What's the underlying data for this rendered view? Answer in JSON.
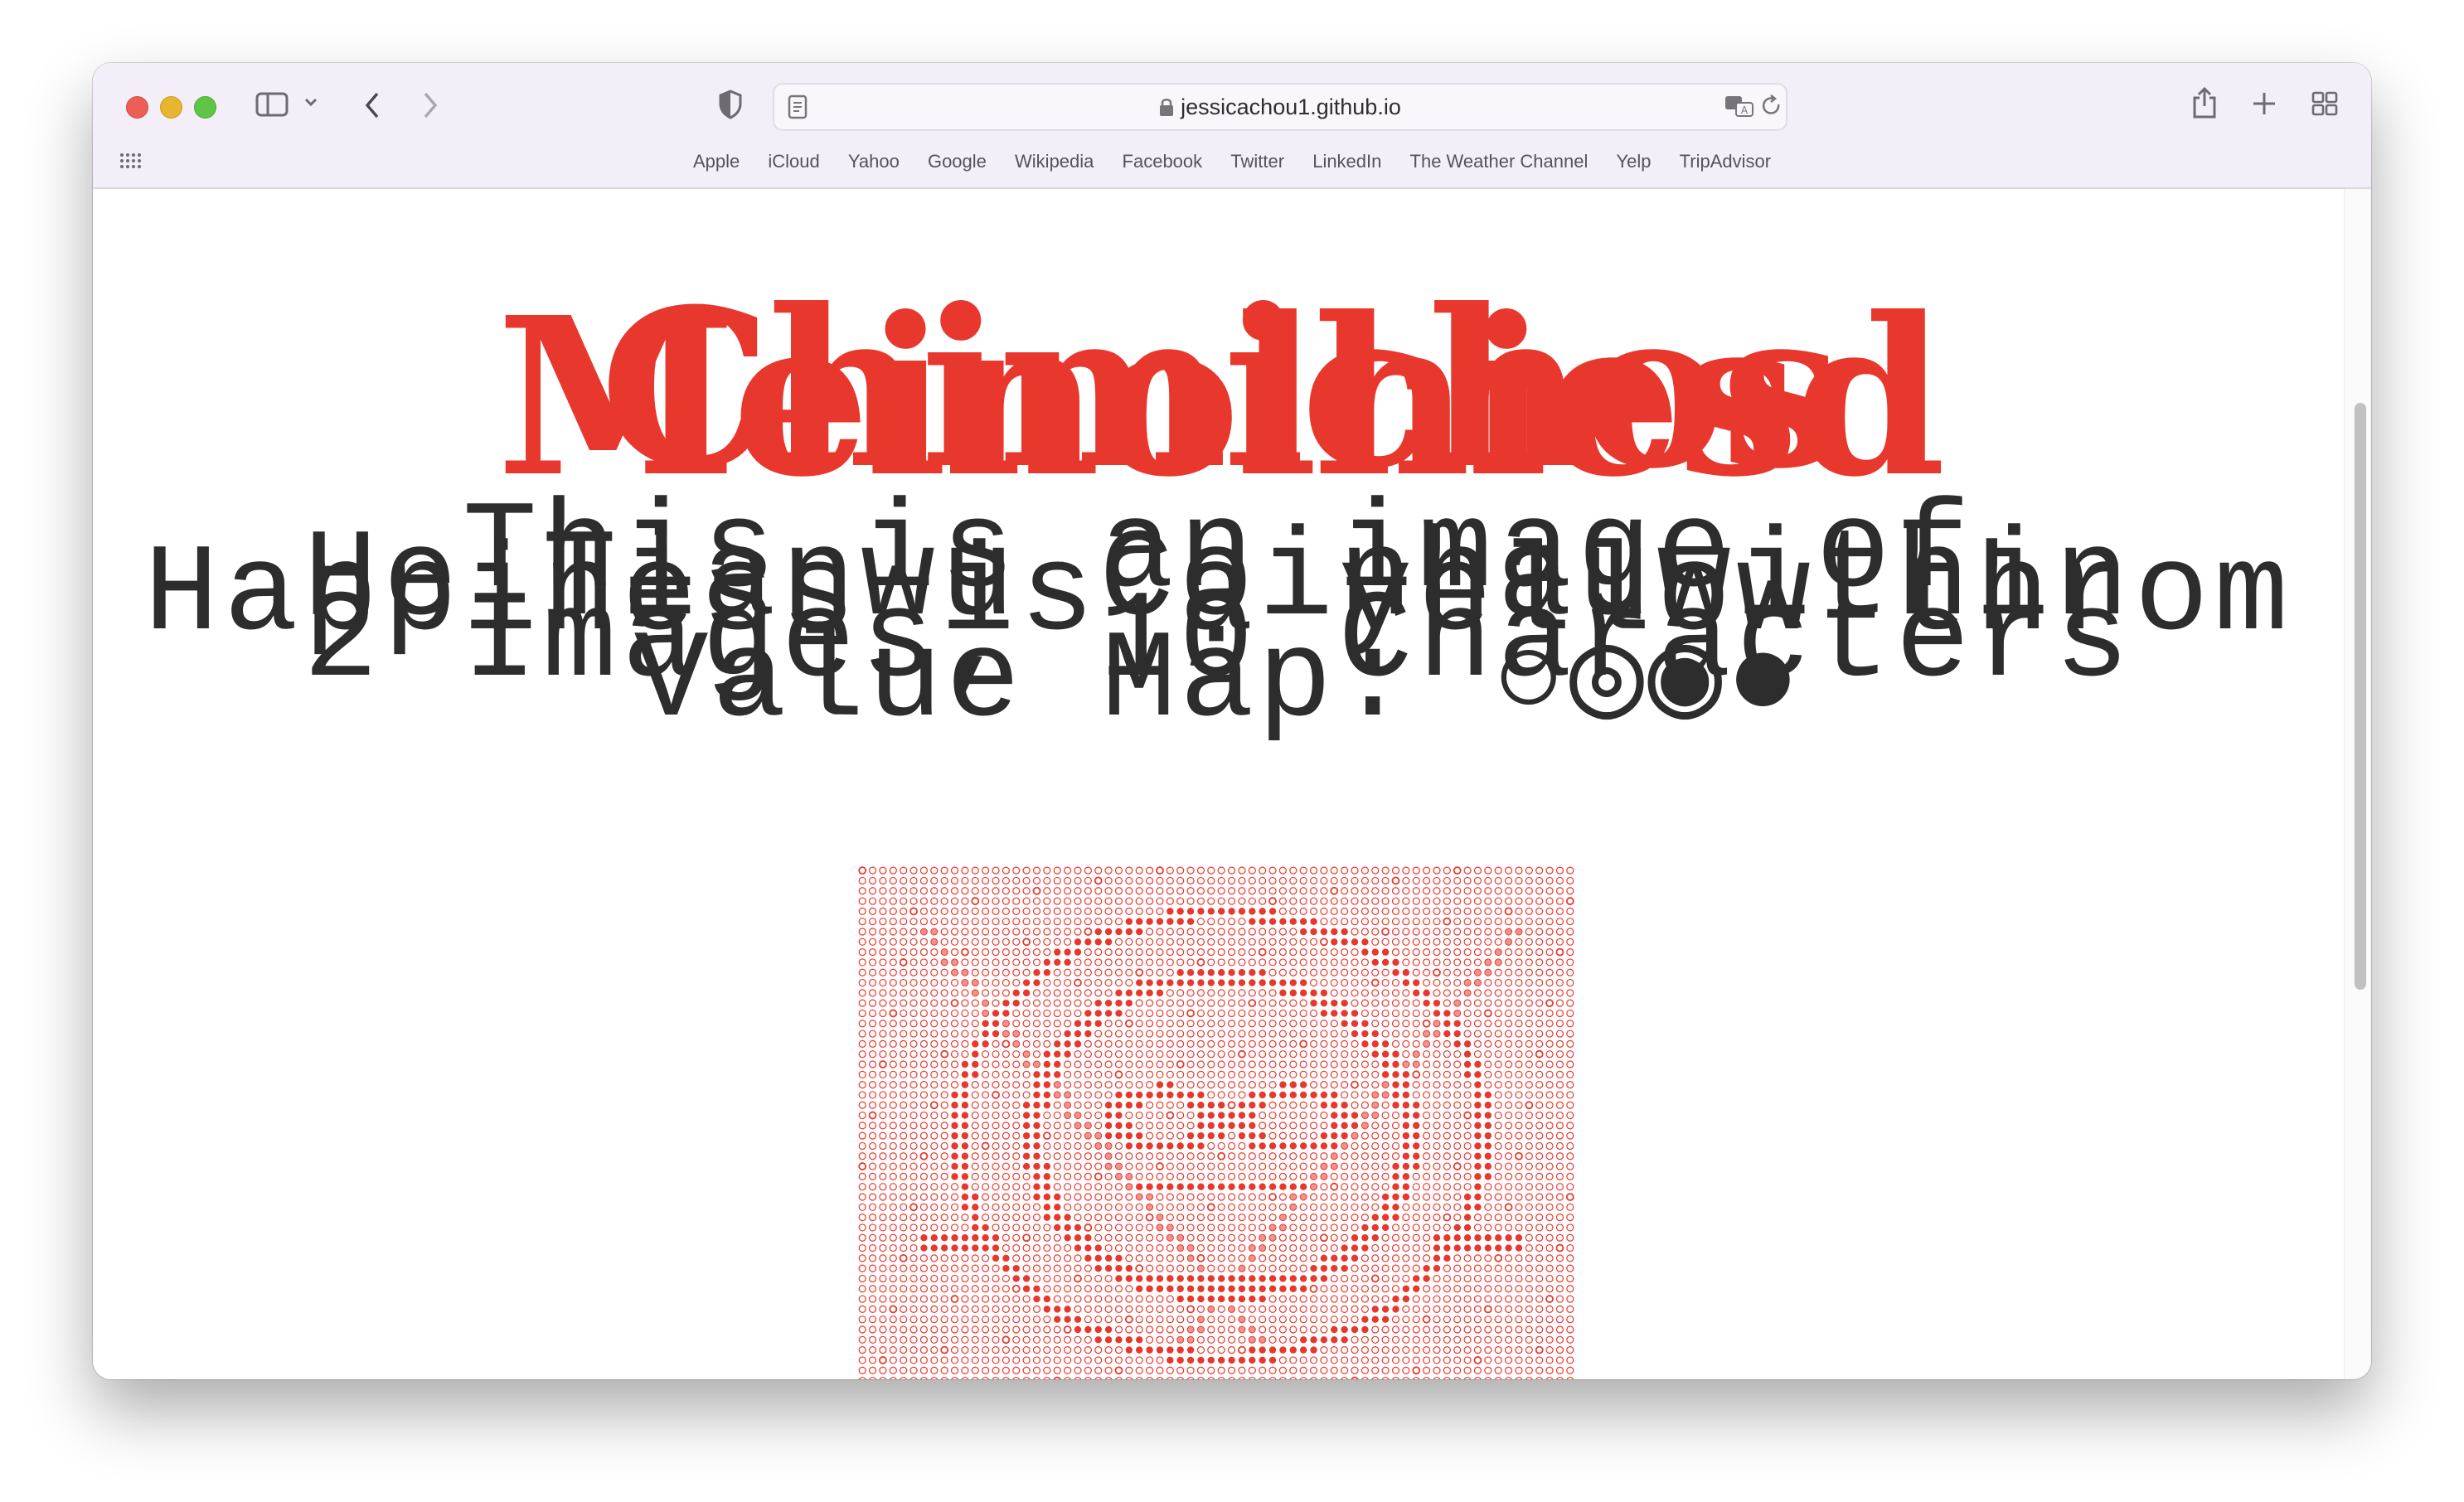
{
  "browser": {
    "url": "jessicachou1.github.io",
    "favorites": [
      "Apple",
      "iCloud",
      "Yahoo",
      "Google",
      "Wikipedia",
      "Facebook",
      "Twitter",
      "LinkedIn",
      "The Weather Channel",
      "Yelp",
      "TripAdvisor"
    ]
  },
  "page": {
    "headline_a": "Chimichos",
    "headline_b": "Meinolhiesd",
    "line1": "This is an image of",
    "line2": "He Tianwu Coinhauwithin",
    "line3": "Happiness is a yellow throm",
    "line4": "2 Images, 10 Characters",
    "line5": "Value Map: ○◎◉●",
    "value_map_symbols": [
      "○",
      "◎",
      "◉",
      "●"
    ],
    "dot_colors": {
      "accent": "#e8382e",
      "text": "#2d2d2d"
    }
  }
}
